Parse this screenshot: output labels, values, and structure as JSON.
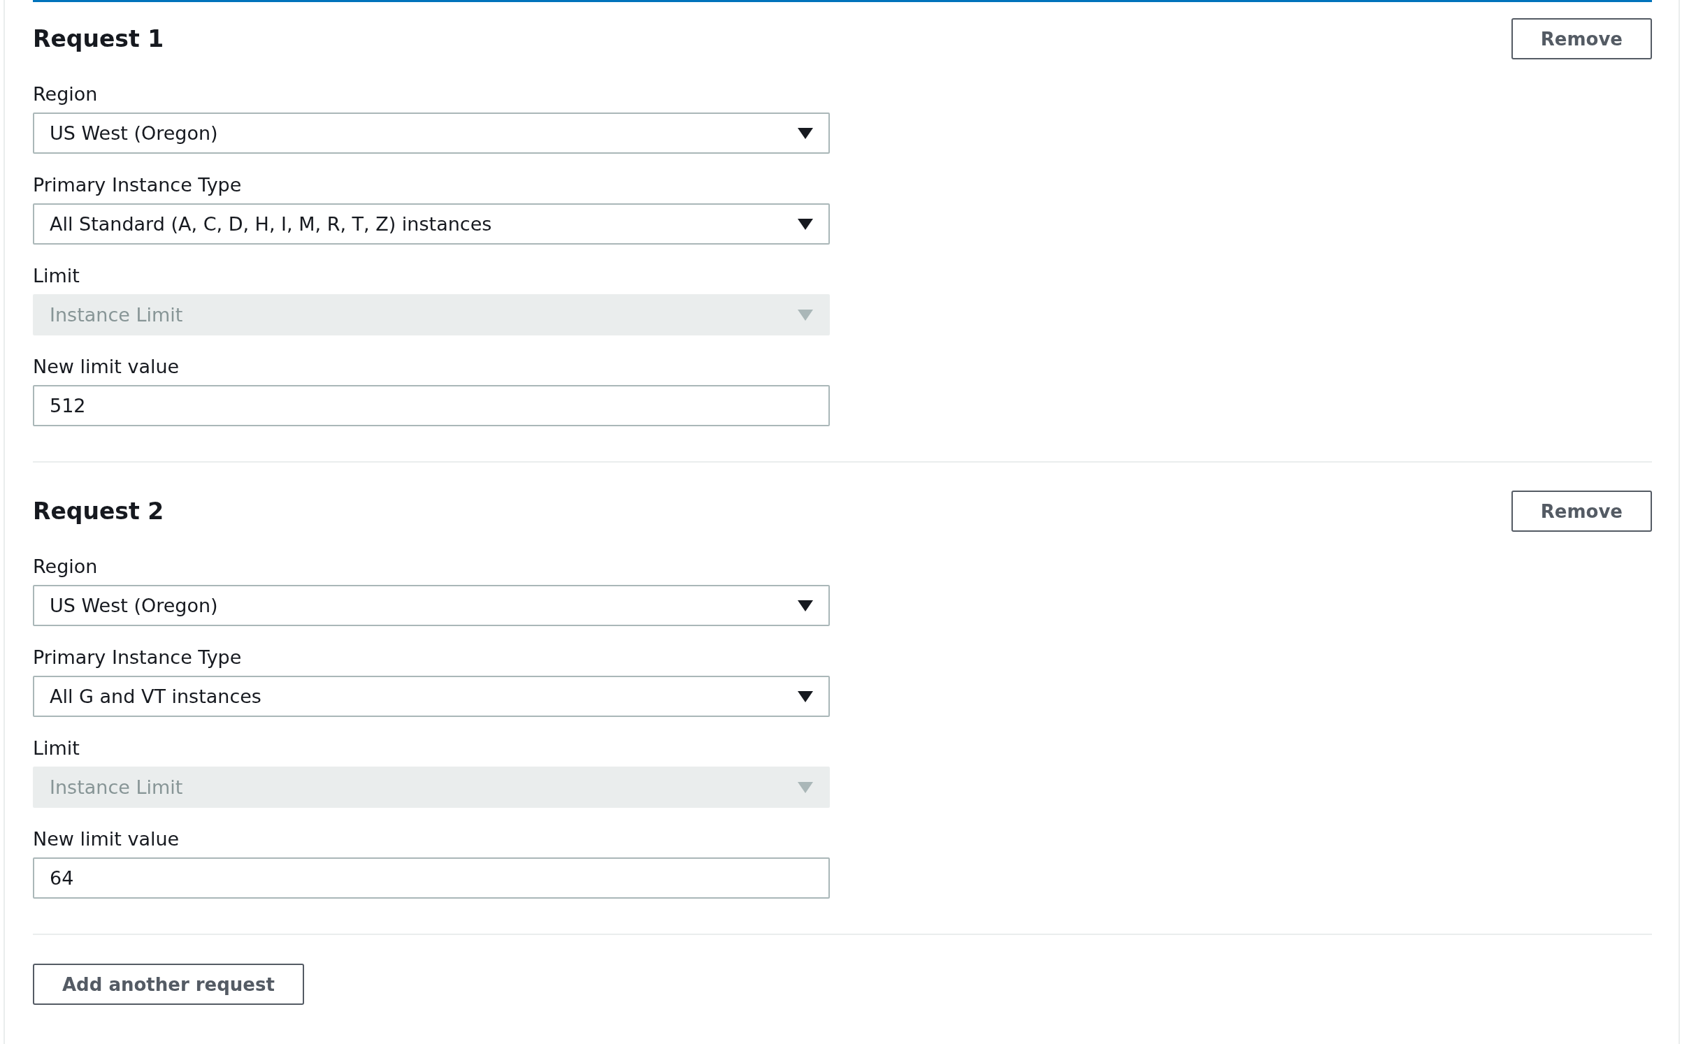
{
  "requests": [
    {
      "heading": "Request 1",
      "remove_button": "Remove",
      "fields": [
        {
          "kind": "select",
          "label": "Region",
          "value": "US West (Oregon)",
          "disabled": false
        },
        {
          "kind": "select",
          "label": "Primary Instance Type",
          "value": "All Standard (A, C, D, H, I, M, R, T, Z) instances",
          "disabled": false
        },
        {
          "kind": "select",
          "label": "Limit",
          "value": "Instance Limit",
          "disabled": true
        },
        {
          "kind": "input",
          "label": "New limit value",
          "value": "512",
          "disabled": false
        }
      ]
    },
    {
      "heading": "Request 2",
      "remove_button": "Remove",
      "fields": [
        {
          "kind": "select",
          "label": "Region",
          "value": "US West (Oregon)",
          "disabled": false
        },
        {
          "kind": "select",
          "label": "Primary Instance Type",
          "value": "All G and VT instances",
          "disabled": false
        },
        {
          "kind": "select",
          "label": "Limit",
          "value": "Instance Limit",
          "disabled": true
        },
        {
          "kind": "input",
          "label": "New limit value",
          "value": "64",
          "disabled": false
        }
      ]
    }
  ],
  "add_button": "Add another request"
}
